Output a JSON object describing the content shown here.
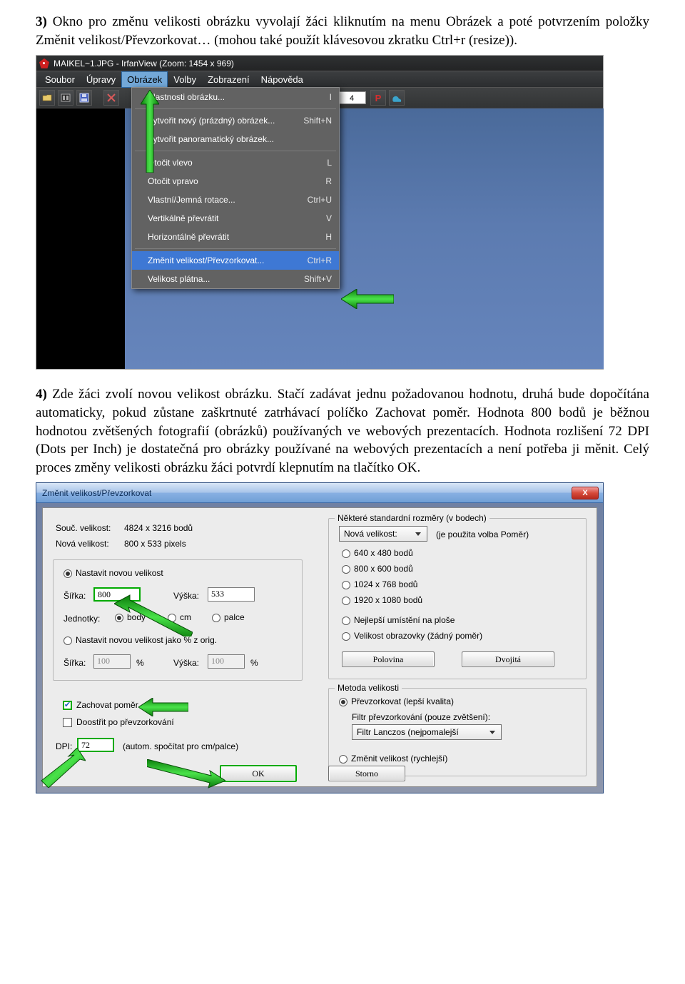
{
  "para3": {
    "lead": "3)",
    "text": " Okno pro změnu velikosti obrázku vyvolají žáci kliknutím na menu Obrázek a poté potvrzením položky Změnit velikost/Převzorkovat… (mohou také použít klávesovou zkratku Ctrl+r (resize))."
  },
  "para4": {
    "lead": "4)",
    "text": " Zde žáci zvolí novou velikost obrázku. Stačí zadávat jednu požadovanou hodnotu, druhá bude dopočítána automaticky, pokud zůstane zaškrtnuté zatrhávací políčko Zachovat poměr. Hodnota 800 bodů je běžnou hodnotou zvětšených fotografií (obrázků) používaných ve webových prezentacích. Hodnota rozlišení 72 DPI (Dots per Inch) je dostatečná pro obrázky používané na webových prezentacích a není potřeba ji měnit. Celý proces změny velikosti obrázku žáci potvrdí klepnutím na tlačítko OK."
  },
  "shot1": {
    "title": "MAIKEL~1.JPG - IrfanView (Zoom: 1454 x 969)",
    "menubar": [
      "Soubor",
      "Úpravy",
      "Obrázek",
      "Volby",
      "Zobrazení",
      "Nápověda"
    ],
    "tbNumber": "4",
    "menu": [
      {
        "label": "Vlastnosti obrázku...",
        "sc": "I"
      },
      {
        "sep": true
      },
      {
        "label": "Vytvořit nový (prázdný) obrázek...",
        "sc": "Shift+N"
      },
      {
        "label": "Vytvořit panoramatický obrázek...",
        "sc": ""
      },
      {
        "sep": true
      },
      {
        "label": "Otočit vlevo",
        "sc": "L"
      },
      {
        "label": "Otočit vpravo",
        "sc": "R"
      },
      {
        "label": "Vlastní/Jemná rotace...",
        "sc": "Ctrl+U"
      },
      {
        "label": "Vertikálně převrátit",
        "sc": "V"
      },
      {
        "label": "Horizontálně převrátit",
        "sc": "H"
      },
      {
        "sep": true
      },
      {
        "label": "Změnit velikost/Převzorkovat...",
        "sc": "Ctrl+R",
        "hl": true
      },
      {
        "label": "Velikost plátna...",
        "sc": "Shift+V"
      }
    ]
  },
  "shot2": {
    "title": "Změnit velikost/Převzorkovat",
    "close": "X",
    "currentLabel": "Souč. velikost:",
    "currentValue": "4824  x  3216 bodů",
    "newLabel": "Nová velikost:",
    "newValue": "800  x  533 pixels",
    "radioSetNew": "Nastavit novou velikost",
    "widthLabel": "Šířka:",
    "widthValue": "800",
    "heightLabel": "Výška:",
    "heightValue": "533",
    "unitsLabel": "Jednotky:",
    "unitBody": "body",
    "unitCm": "cm",
    "unitInch": "palce",
    "radioSetPct": "Nastavit novou velikost jako % z orig.",
    "pctWidthLabel": "Šířka:",
    "pctWidthValue": "100",
    "pctUnit1": "%",
    "pctHeightLabel": "Výška:",
    "pctHeightValue": "100",
    "pctUnit2": "%",
    "keepRatio": "Zachovat poměr",
    "sharpen": "Doostřit po převzorkování",
    "dpiLabel": "DPI:",
    "dpiValue": "72",
    "dpiNote": "(autom. spočítat pro cm/palce)",
    "stdTitle": "Některé standardní rozměry (v bodech)",
    "stdCombo": "Nová velikost:",
    "stdNote": "(je použita volba Poměr)",
    "stdOpts": [
      "640 x 480 bodů",
      "800 x 600 bodů",
      "1024 x 768 bodů",
      "1920 x 1080 bodů"
    ],
    "bestFit": "Nejlepší umístění na ploše",
    "screenSize": "Velikost obrazovky (žádný poměr)",
    "half": "Polovina",
    "double": "Dvojitá",
    "methodTitle": "Metoda velikosti",
    "methodResample": "Převzorkovat (lepší kvalita)",
    "filterLabel": "Filtr převzorkování (pouze zvětšení):",
    "filterCombo": "Filtr Lanczos (nejpomalejší",
    "methodResize": "Změnit velikost (rychlejší)",
    "ok": "OK",
    "cancel": "Storno"
  }
}
